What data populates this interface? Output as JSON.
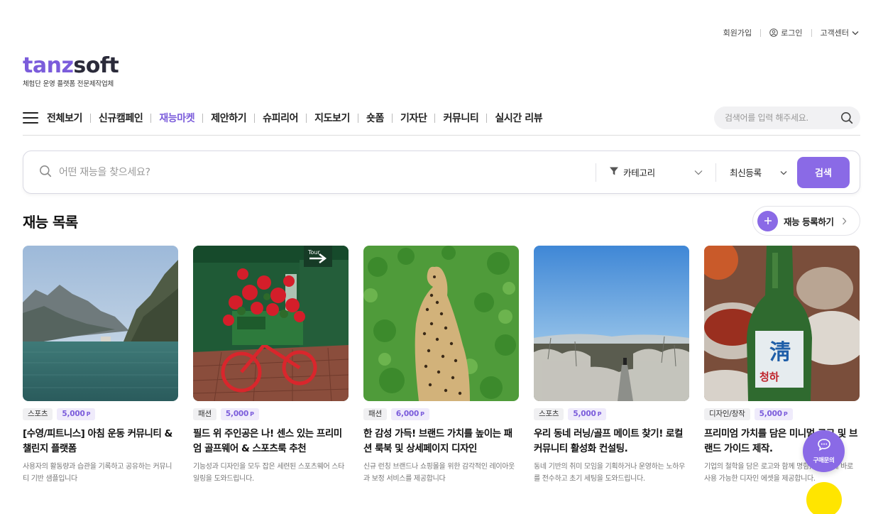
{
  "utility": {
    "signup": "회원가입",
    "login": "로그인",
    "support": "고객센터"
  },
  "logo": {
    "part1": "tanz",
    "part2": "soft",
    "tagline": "체험단 운영 플랫폼 전문제작업체"
  },
  "nav": {
    "items": [
      {
        "label": "전체보기"
      },
      {
        "label": "신규캠페인"
      },
      {
        "label": "재능마켓",
        "active": true
      },
      {
        "label": "제안하기"
      },
      {
        "label": "슈피리어"
      },
      {
        "label": "지도보기"
      },
      {
        "label": "숏폼"
      },
      {
        "label": "기자단"
      },
      {
        "label": "커뮤니티"
      },
      {
        "label": "실시간 리뷰"
      }
    ],
    "search_placeholder": "검색어를 입력 해주세요."
  },
  "filter": {
    "query_placeholder": "어떤 재능을 찾으세요?",
    "category": "카테고리",
    "sort": "최신등록",
    "submit": "검색"
  },
  "section": {
    "title": "재능 목록",
    "register_label": "재능 등록하기"
  },
  "cards": [
    {
      "category": "스포츠",
      "price": "5,000",
      "unit": "P",
      "title": "[수영/피트니스] 아침 운동 커뮤니티 & 챌린지 플랫폼",
      "desc": "사용자의 활동량과 습관을 기록하고 공유하는 커뮤니티 기반 샘플입니다",
      "image": "lake-mountain"
    },
    {
      "category": "패션",
      "price": "5,000",
      "unit": "P",
      "title": "필드 위 주인공은 나! 센스 있는 프리미엄 골프웨어 & 스포츠룩 추천",
      "desc": "기능성과 디자인을 모두 잡은 세련된 스포츠웨어 스타일링을 도와드립니다.",
      "image": "flower-bicycle"
    },
    {
      "category": "패션",
      "price": "6,000",
      "unit": "P",
      "title": "한 감성 가득! 브랜드 가치를 높이는 패션 룩북 및 상세페이지 디자인",
      "desc": "신규 런칭 브랜드나 쇼핑몰을 위한 감각적인 레이아웃과 보정 서비스를 제공합니다",
      "image": "cheetah"
    },
    {
      "category": "스포츠",
      "price": "5,000",
      "unit": "P",
      "title": "우리 동네 러닝/골프 메이트 찾기! 로컬 커뮤니티 활성화 컨설팅.",
      "desc": "동네 기반의 취미 모임을 기획하거나 운영하는 노하우를 전수하고 초기 세팅을 도와드립니다.",
      "image": "field-sky"
    },
    {
      "category": "디자인/창작",
      "price": "5,000",
      "unit": "P",
      "title": "프리미엄 가치를 담은 미니멀 로고 및 브랜드 가이드 제작.",
      "desc": "기업의 철학을 담은 로고와 함께 명함, 인쇄물에 바로 사용 가능한 디자인 에셋을 제공합니다.",
      "image": "soju-bottle"
    }
  ],
  "floating": {
    "inquiry": "구매문의"
  },
  "colors": {
    "accent": "#8a6ae6",
    "accent_text": "#7b5cdb",
    "kakao": "#ffe500"
  }
}
